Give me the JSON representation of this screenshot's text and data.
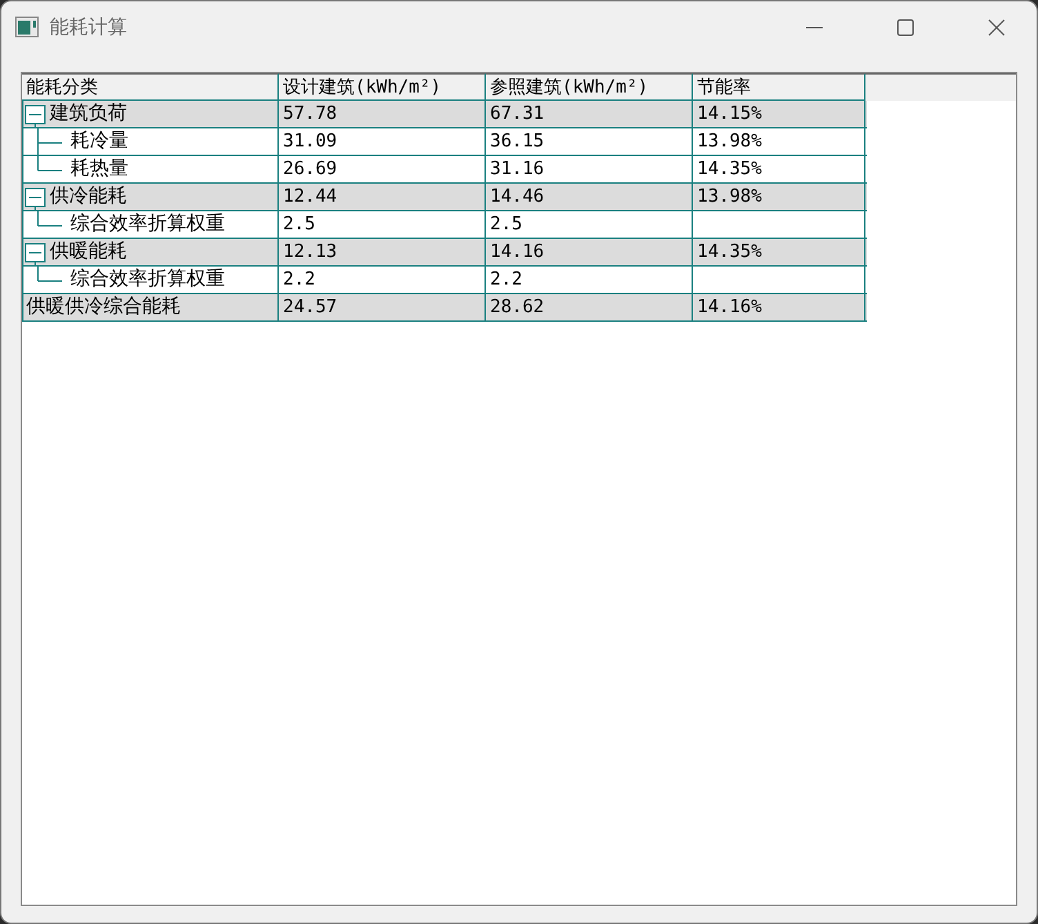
{
  "window": {
    "title": "能耗计算"
  },
  "table": {
    "columns": [
      "能耗分类",
      "设计建筑(kWh/m²)",
      "参照建筑(kWh/m²)",
      "节能率"
    ],
    "rows": [
      {
        "label": "建筑负荷",
        "design": "57.78",
        "reference": "67.31",
        "saving_rate": "14.15%",
        "expanded": true,
        "children": [
          {
            "label": "耗冷量",
            "design": "31.09",
            "reference": "36.15",
            "saving_rate": "13.98%"
          },
          {
            "label": "耗热量",
            "design": "26.69",
            "reference": "31.16",
            "saving_rate": "14.35%"
          }
        ]
      },
      {
        "label": "供冷能耗",
        "design": "12.44",
        "reference": "14.46",
        "saving_rate": "13.98%",
        "expanded": true,
        "children": [
          {
            "label": "综合效率折算权重",
            "design": "2.5",
            "reference": "2.5"
          }
        ]
      },
      {
        "label": "供暖能耗",
        "design": "12.13",
        "reference": "14.16",
        "saving_rate": "14.35%",
        "expanded": true,
        "children": [
          {
            "label": "综合效率折算权重",
            "design": "2.2",
            "reference": "2.2"
          }
        ]
      },
      {
        "label": "供暖供冷综合能耗",
        "design": "24.57",
        "reference": "28.62",
        "saving_rate": "14.16%"
      }
    ]
  }
}
